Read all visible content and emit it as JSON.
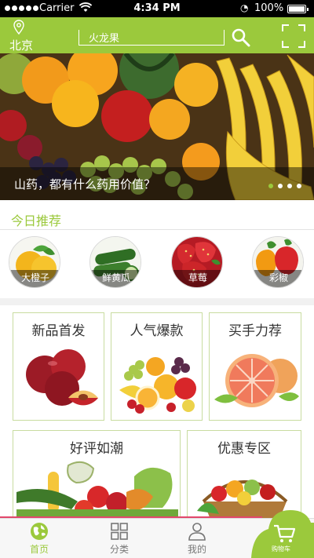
{
  "status_bar": {
    "carrier": "Carrier",
    "time": "4:34 PM",
    "battery": "100%",
    "battery_level": 1.0
  },
  "header": {
    "city": "北京",
    "search_value": "火龙果"
  },
  "banner": {
    "caption": "山药，都有什么药用价值？",
    "page_count": 4,
    "active_page": 1
  },
  "recommend": {
    "title": "今日推荐",
    "items": [
      {
        "label": "大橙子",
        "icon": "orange-icon"
      },
      {
        "label": "鲜黄瓜",
        "icon": "cucumber-icon"
      },
      {
        "label": "草莓",
        "icon": "strawberry-icon"
      },
      {
        "label": "彩椒",
        "icon": "bell-pepper-icon"
      }
    ]
  },
  "categories": [
    {
      "title": "新品首发",
      "image": "plums-image"
    },
    {
      "title": "人气爆款",
      "image": "fruit-mix-image"
    },
    {
      "title": "买手力荐",
      "image": "grapefruit-image"
    },
    {
      "title": "好评如潮",
      "image": "vegetables-image"
    },
    {
      "title": "优惠专区",
      "image": "fruit-basket-image"
    }
  ],
  "tabbar": {
    "items": [
      {
        "label": "首页",
        "icon": "globe-icon",
        "active": true
      },
      {
        "label": "分类",
        "icon": "grid-icon",
        "active": false
      },
      {
        "label": "我的",
        "icon": "user-icon",
        "active": false
      }
    ],
    "cart_label": "购物车"
  },
  "colors": {
    "brand_green": "#9bc93c",
    "card_border": "#c8dca0",
    "accent_pink": "#e2476b"
  }
}
